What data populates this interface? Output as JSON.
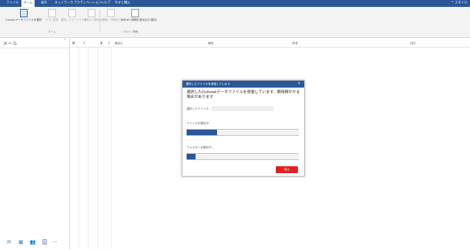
{
  "menu": {
    "tabs": [
      "ファイル",
      "ホーム",
      "表示",
      "ネットワーク",
      "アクティベーション",
      "ヘルプ",
      "今すぐ購入"
    ],
    "active_index": 1,
    "right_label": "^ スタイル"
  },
  "ribbon": {
    "buttons": [
      {
        "label": "Outlookデータファイルを選択",
        "enabled": true
      },
      {
        "label": "PSTに変換",
        "enabled": false
      },
      {
        "label": "選択したファイルを表示",
        "enabled": false
      },
      {
        "label": "スキャン情報を保存",
        "enabled": false
      },
      {
        "label": "スキャン情報を読み込む",
        "enabled": false
      },
      {
        "label": "スキャン情報を読み込む(保存)",
        "enabled": true
      }
    ],
    "groups": [
      "ホーム",
      "スキャン情報"
    ]
  },
  "sidebar": {
    "title": "メール",
    "collapse": "^",
    "nav_icons": [
      "mail-icon",
      "calendar-icon",
      "contacts-icon",
      "tasks-icon",
      "more-icon"
    ],
    "nav_glyphs": [
      "✉",
      "▦",
      "👥",
      "🗒",
      "···"
    ]
  },
  "list": {
    "columns": [
      "0",
      "!",
      "3",
      "!",
      "差出人",
      "宛先",
      "件名",
      "日付"
    ]
  },
  "dialog": {
    "title": "選択したファイルを修復しています",
    "close": "×",
    "heading": "選択したOutlookデータファイルを修復しています。数時間かかる場合があります",
    "file_label": "選択したファイル：",
    "file_progress_label": "ファイルを解析中...",
    "file_progress": 0.27,
    "folder_progress_label": "フォルダーを解析中...",
    "folder_progress": 0.08,
    "cancel": "停止"
  },
  "colors": {
    "accent": "#2b579a",
    "cancel": "#e02020"
  }
}
